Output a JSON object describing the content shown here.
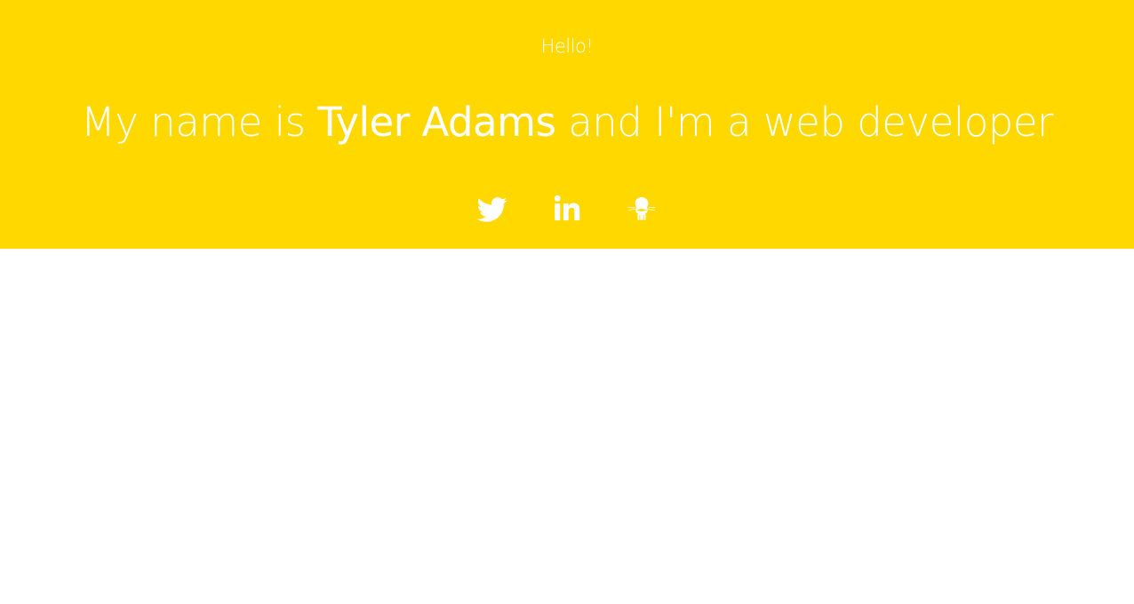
{
  "hero": {
    "greeting": "Hello!",
    "headline_prefix": "My name is ",
    "headline_name": "Tyler Adams",
    "headline_suffix": " and I'm a web developer",
    "background_color": "#FFD800",
    "text_color": "#FFFFFF"
  },
  "social_links": [
    {
      "name": "twitter",
      "icon": "twitter-icon"
    },
    {
      "name": "linkedin",
      "icon": "linkedin-icon"
    },
    {
      "name": "github",
      "icon": "github-icon"
    }
  ]
}
